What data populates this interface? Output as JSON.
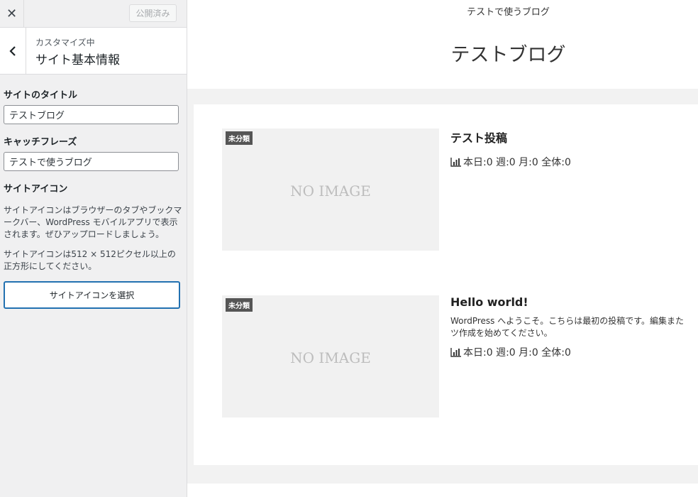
{
  "sidebar": {
    "close_glyph": "✕",
    "publish_label": "公開済み",
    "customizing_label": "カスタマイズ中",
    "section_title": "サイト基本情報",
    "site_title_label": "サイトのタイトル",
    "site_title_value": "テストブログ",
    "tagline_label": "キャッチフレーズ",
    "tagline_value": "テストで使うブログ",
    "site_icon_label": "サイトアイコン",
    "site_icon_desc_1": "サイトアイコンはブラウザーのタブやブックマークバー、WordPress モバイルアプリで表示されます。ぜひアップロードしましょう。",
    "site_icon_desc_2": "サイトアイコンは512 × 512ピクセル以上の正方形にしてください。",
    "select_icon_label": "サイトアイコンを選択"
  },
  "preview": {
    "tagline": "テストで使うブログ",
    "site_title": "テストブログ",
    "posts": [
      {
        "category": "未分類",
        "thumb_text": "NO IMAGE",
        "title": "テスト投稿",
        "excerpt": "",
        "views": "本日:0 週:0 月:0 全体:0"
      },
      {
        "category": "未分類",
        "thumb_text": "NO IMAGE",
        "title": "Hello world!",
        "excerpt": "WordPress へようこそ。こちらは最初の投稿です。編集また\nツ作成を始めてください。",
        "views": "本日:0 週:0 月:0 全体:0"
      }
    ]
  },
  "colors": {
    "sidebar_bg": "#f0f0f1",
    "accent": "#2271b1",
    "badge_bg": "#555555",
    "preview_bg": "#f2f2f2"
  }
}
